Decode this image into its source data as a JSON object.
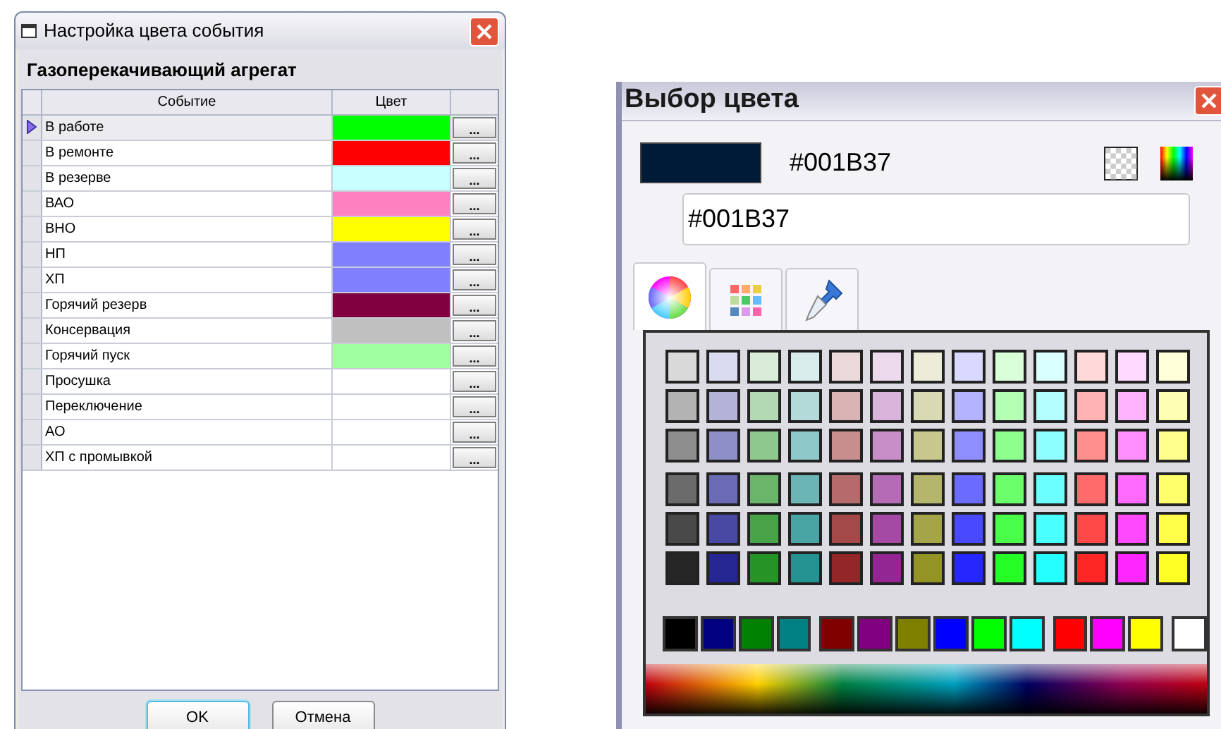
{
  "event_dialog": {
    "title": "Настройка цвета события",
    "subtitle": "Газоперекачивающий агрегат",
    "columns": [
      "Событие",
      "Цвет"
    ],
    "rows": [
      {
        "name": "В работе",
        "color": "#00ff00",
        "selected": true
      },
      {
        "name": "В ремонте",
        "color": "#ff0000",
        "selected": false
      },
      {
        "name": "В резерве",
        "color": "#c8ffff",
        "selected": false
      },
      {
        "name": "ВАО",
        "color": "#ff80c0",
        "selected": false
      },
      {
        "name": "ВНО",
        "color": "#ffff00",
        "selected": false
      },
      {
        "name": "НП",
        "color": "#8080ff",
        "selected": false
      },
      {
        "name": "ХП",
        "color": "#8080ff",
        "selected": false
      },
      {
        "name": "Горячий резерв",
        "color": "#800040",
        "selected": false
      },
      {
        "name": "Консервация",
        "color": "#c0c0c0",
        "selected": false
      },
      {
        "name": "Горячий пуск",
        "color": "#a0ffa0",
        "selected": false
      },
      {
        "name": "Просушка",
        "selected": false
      },
      {
        "name": "Переключение",
        "selected": false
      },
      {
        "name": "АО",
        "selected": false
      },
      {
        "name": "ХП с промывкой",
        "selected": false
      }
    ],
    "row_button": "...",
    "buttons": [
      {
        "label": "OK",
        "default": true
      },
      {
        "label": "Отмена",
        "default": false
      }
    ]
  },
  "color_dialog": {
    "title": "Выбор цвета",
    "preview": {
      "color": "#001b37"
    },
    "hex_label": "#001B37",
    "hex_field": {
      "value": "#001B37"
    },
    "tabs": [
      {
        "kind": "wheel",
        "selected": true
      },
      {
        "kind": "grid",
        "selected": false
      },
      {
        "kind": "eyedropper",
        "selected": false
      }
    ],
    "palette": [
      {
        "swatches": [
          {
            "color": "#d9d9d9"
          },
          {
            "color": "#dadaf0"
          },
          {
            "color": "#d9ecd9"
          },
          {
            "color": "#d9ecec"
          },
          {
            "color": "#ecd9d9"
          },
          {
            "color": "#ecd9ec"
          },
          {
            "color": "#ececd9"
          },
          {
            "color": "#d9d9ff"
          },
          {
            "color": "#d9ffd9"
          },
          {
            "color": "#d9ffff"
          },
          {
            "color": "#ffd9d9"
          },
          {
            "color": "#ffd9ff"
          },
          {
            "color": "#ffffd9"
          }
        ]
      },
      {
        "swatches": [
          {
            "color": "#b3b3b3"
          },
          {
            "color": "#b3b3d9"
          },
          {
            "color": "#b3d9b3"
          },
          {
            "color": "#b3d9d9"
          },
          {
            "color": "#d9b3b3"
          },
          {
            "color": "#d9b3d9"
          },
          {
            "color": "#d9d9b3"
          },
          {
            "color": "#b3b3ff"
          },
          {
            "color": "#b3ffb3"
          },
          {
            "color": "#b3ffff"
          },
          {
            "color": "#ffb3b3"
          },
          {
            "color": "#ffb3ff"
          },
          {
            "color": "#ffffb3"
          }
        ]
      },
      {
        "swatches": [
          {
            "color": "#8e8e8e"
          },
          {
            "color": "#8e8ec8"
          },
          {
            "color": "#8ec88e"
          },
          {
            "color": "#8ec8c8"
          },
          {
            "color": "#c88e8e"
          },
          {
            "color": "#c88ec8"
          },
          {
            "color": "#c8c88e"
          },
          {
            "color": "#8e8eff"
          },
          {
            "color": "#8eff8e"
          },
          {
            "color": "#8effff"
          },
          {
            "color": "#ff8e8e"
          },
          {
            "color": "#ff8eff"
          },
          {
            "color": "#ffff8e"
          }
        ]
      },
      {
        "swatches": [
          {
            "color": "#6b6b6b"
          },
          {
            "color": "#6b6bb5"
          },
          {
            "color": "#6bb56b"
          },
          {
            "color": "#6bb5b5"
          },
          {
            "color": "#b56b6b"
          },
          {
            "color": "#b56bb5"
          },
          {
            "color": "#b5b56b"
          },
          {
            "color": "#6b6bff"
          },
          {
            "color": "#6bff6b"
          },
          {
            "color": "#6bffff"
          },
          {
            "color": "#ff6b6b"
          },
          {
            "color": "#ff6bff"
          },
          {
            "color": "#ffff6b"
          }
        ]
      },
      {
        "swatches": [
          {
            "color": "#494949"
          },
          {
            "color": "#4949a4"
          },
          {
            "color": "#49a449"
          },
          {
            "color": "#49a4a4"
          },
          {
            "color": "#a44949"
          },
          {
            "color": "#a449a4"
          },
          {
            "color": "#a4a449"
          },
          {
            "color": "#4949ff"
          },
          {
            "color": "#49ff49"
          },
          {
            "color": "#49ffff"
          },
          {
            "color": "#ff4949"
          },
          {
            "color": "#ff49ff"
          },
          {
            "color": "#ffff49"
          }
        ]
      },
      {
        "swatches": [
          {
            "color": "#262626"
          },
          {
            "color": "#262693"
          },
          {
            "color": "#269326"
          },
          {
            "color": "#269393"
          },
          {
            "color": "#932626"
          },
          {
            "color": "#932693"
          },
          {
            "color": "#939326"
          },
          {
            "color": "#2626ff"
          },
          {
            "color": "#26ff26"
          },
          {
            "color": "#26ffff"
          },
          {
            "color": "#ff2626"
          },
          {
            "color": "#ff26ff"
          },
          {
            "color": "#ffff26"
          }
        ]
      }
    ],
    "basic_colors": [
      {
        "color": "#000000"
      },
      {
        "color": "#000080"
      },
      {
        "color": "#008000"
      },
      {
        "color": "#008080"
      },
      {
        "color": "#800000"
      },
      {
        "color": "#800080"
      },
      {
        "color": "#808000"
      },
      {
        "color": "#0000ff"
      },
      {
        "color": "#00ff00"
      },
      {
        "color": "#00ffff"
      },
      {
        "color": "#ff0000"
      },
      {
        "color": "#ff00ff"
      },
      {
        "color": "#ffff00"
      },
      {
        "color": "#ffffff"
      }
    ]
  }
}
